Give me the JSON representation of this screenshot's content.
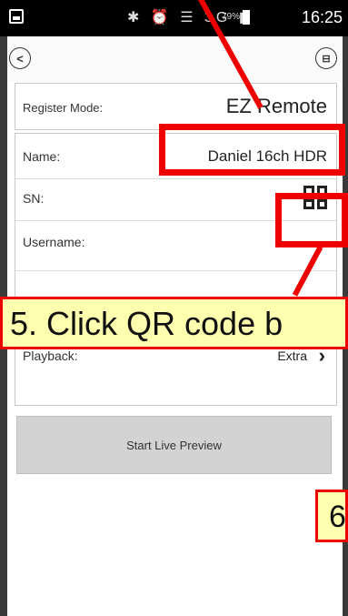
{
  "status_bar": {
    "icons": "✱ ⏰ ☰ 3G ▮",
    "battery": "79%",
    "time": "16:25"
  },
  "header": {
    "back_icon": "back-icon",
    "back_glyph": "<",
    "save_icon": "save-icon",
    "save_glyph": "⊟"
  },
  "form": {
    "register_mode": {
      "label": "Register Mode:",
      "value": "EZ Remote"
    },
    "name": {
      "label": "Name:",
      "value": "Daniel 16ch HDR"
    },
    "sn": {
      "label": "SN:"
    },
    "username": {
      "label": "Username:"
    },
    "playback": {
      "label": "Playback:",
      "value": "Extra",
      "chevron": "›"
    }
  },
  "start_live_preview": "Start Live Preview",
  "annotations": {
    "step5": "5. Click QR code b",
    "step6": "6"
  },
  "colors": {
    "highlight": "#ee0000",
    "callout_bg": "#ffffb0",
    "button_bg": "#d3d3d3"
  }
}
